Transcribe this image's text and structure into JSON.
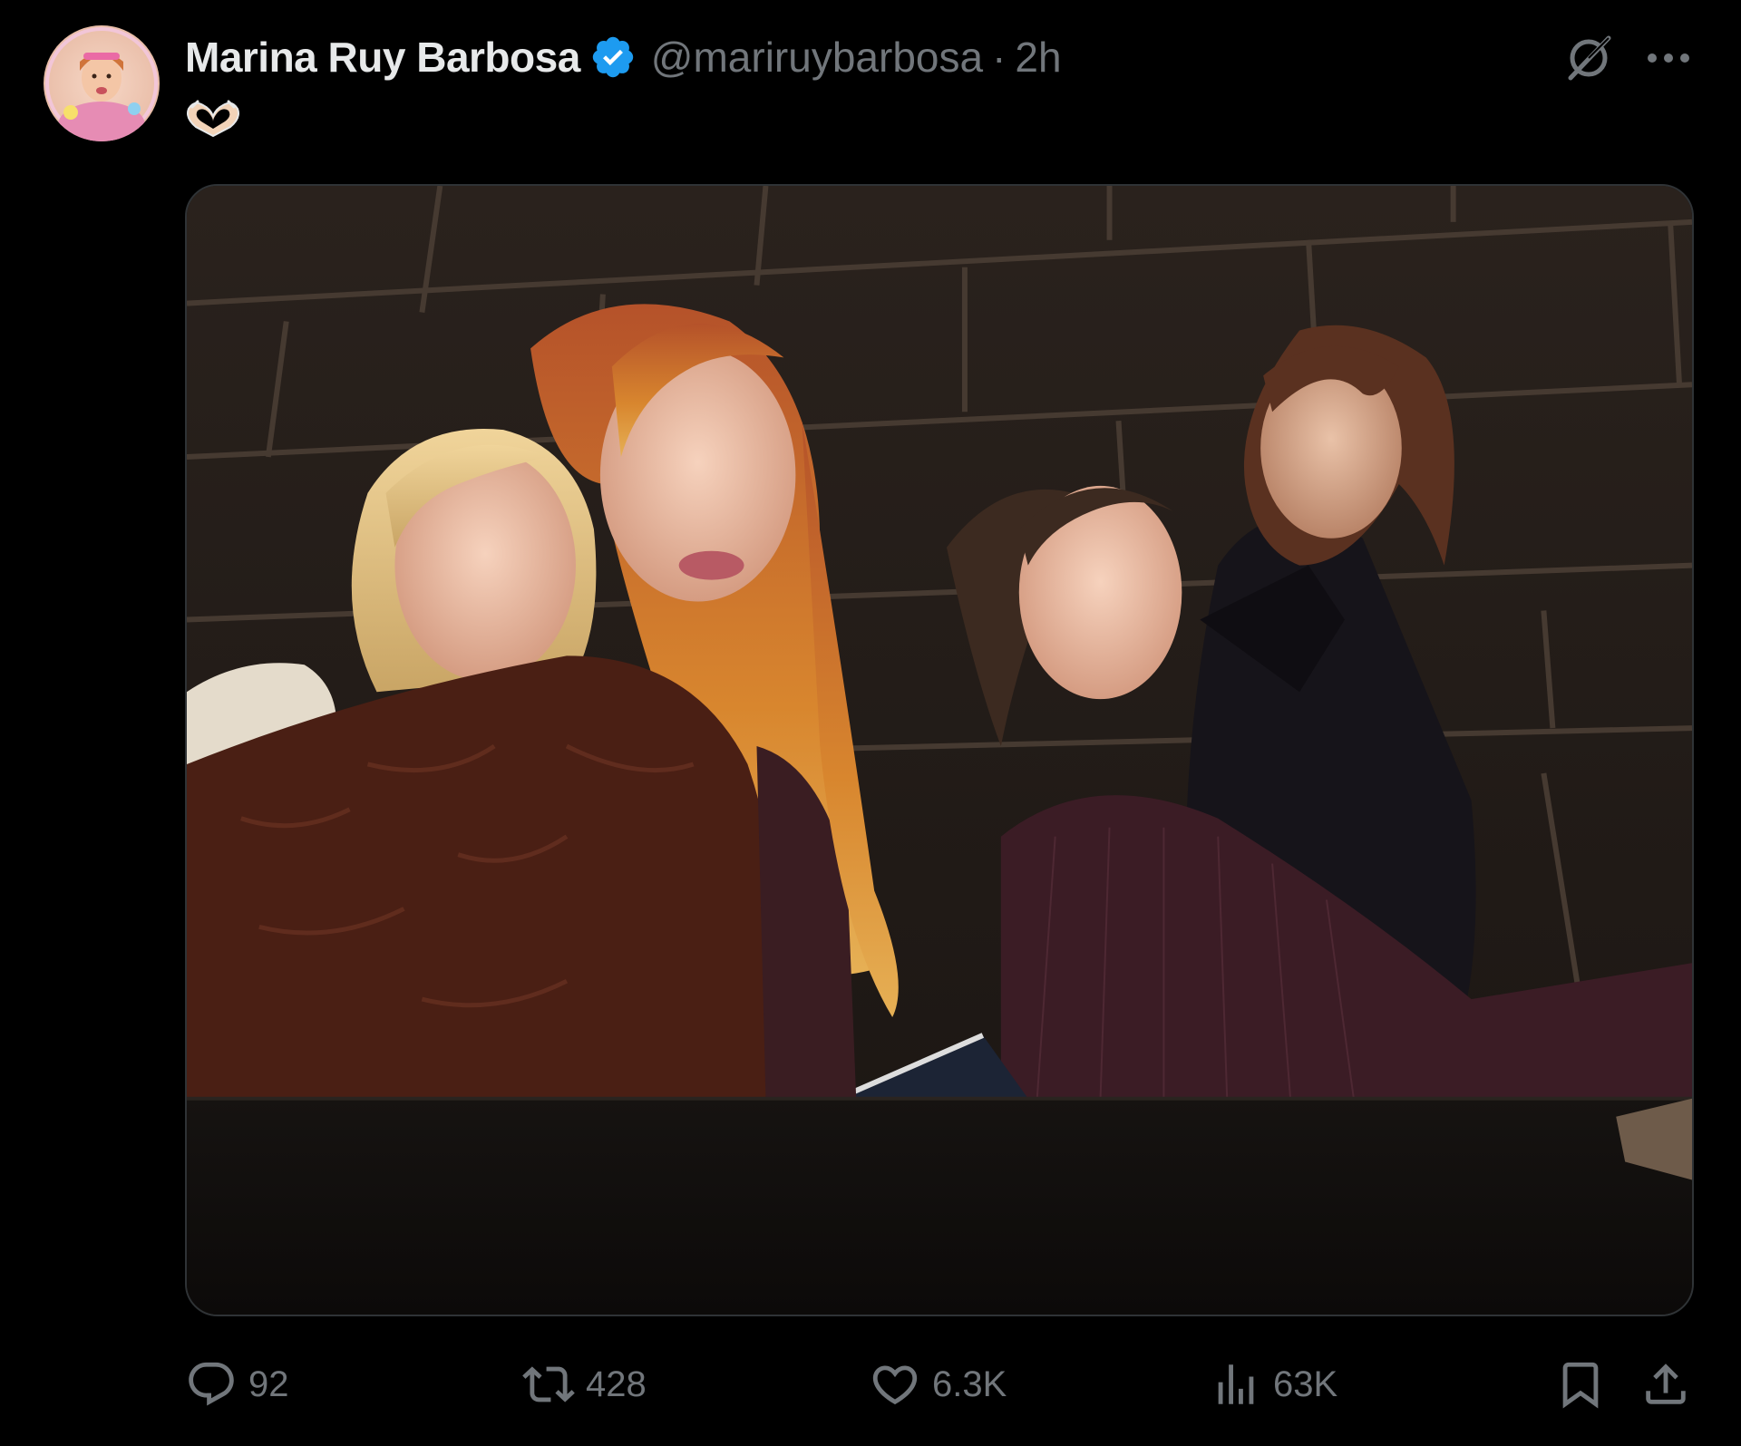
{
  "author": {
    "display_name": "Marina Ruy Barbosa",
    "handle": "@mariruybarbosa",
    "separator": "·",
    "time_ago": "2h",
    "verified": true,
    "verified_color": "#1d9bf0"
  },
  "tweet": {
    "text_emoji": "heart-hands-emoji",
    "media_alt": ""
  },
  "actions": {
    "replies": "92",
    "retweets": "428",
    "likes": "6.3K",
    "views": "63K"
  },
  "icons": {
    "grok": "grok-icon",
    "more": "more-icon",
    "reply": "reply-icon",
    "retweet": "retweet-icon",
    "like": "heart-icon",
    "views": "views-chart-icon",
    "bookmark": "bookmark-icon",
    "share": "share-icon"
  },
  "colors": {
    "background": "#000000",
    "primary_text": "#e7e9ea",
    "secondary_text": "#71767b",
    "border": "#2f3336"
  }
}
